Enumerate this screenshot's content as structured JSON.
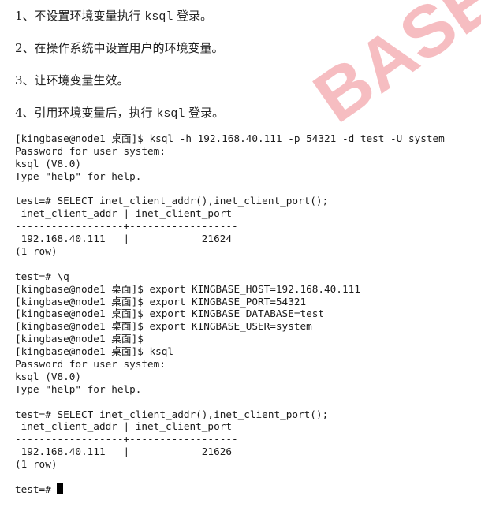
{
  "steps": [
    {
      "prefix": "1、不设置环境变量执行 ",
      "code": "ksql",
      "suffix": " 登录。"
    },
    {
      "prefix": "2、在操作系统中设置用户的环境变量。",
      "code": "",
      "suffix": ""
    },
    {
      "prefix": "3、让环境变量生效。",
      "code": "",
      "suffix": ""
    },
    {
      "prefix": "4、引用环境变量后，执行 ",
      "code": "ksql",
      "suffix": " 登录。"
    }
  ],
  "terminal": {
    "lines": [
      "[kingbase@node1 桌面]$ ksql -h 192.168.40.111 -p 54321 -d test -U system",
      "Password for user system:",
      "ksql (V8.0)",
      "Type \"help\" for help.",
      "",
      "test=# SELECT inet_client_addr(),inet_client_port();",
      " inet_client_addr | inet_client_port",
      "------------------+------------------",
      " 192.168.40.111   |            21624",
      "(1 row)",
      "",
      "test=# \\q",
      "[kingbase@node1 桌面]$ export KINGBASE_HOST=192.168.40.111",
      "[kingbase@node1 桌面]$ export KINGBASE_PORT=54321",
      "[kingbase@node1 桌面]$ export KINGBASE_DATABASE=test",
      "[kingbase@node1 桌面]$ export KINGBASE_USER=system",
      "[kingbase@node1 桌面]$",
      "[kingbase@node1 桌面]$ ksql",
      "Password for user system:",
      "ksql (V8.0)",
      "Type \"help\" for help.",
      "",
      "test=# SELECT inet_client_addr(),inet_client_port();",
      " inet_client_addr | inet_client_port",
      "------------------+------------------",
      " 192.168.40.111   |            21626",
      "(1 row)",
      ""
    ],
    "final_prompt": "test=# "
  },
  "watermark": {
    "text": "BASE",
    "color": "#f2aab0"
  }
}
